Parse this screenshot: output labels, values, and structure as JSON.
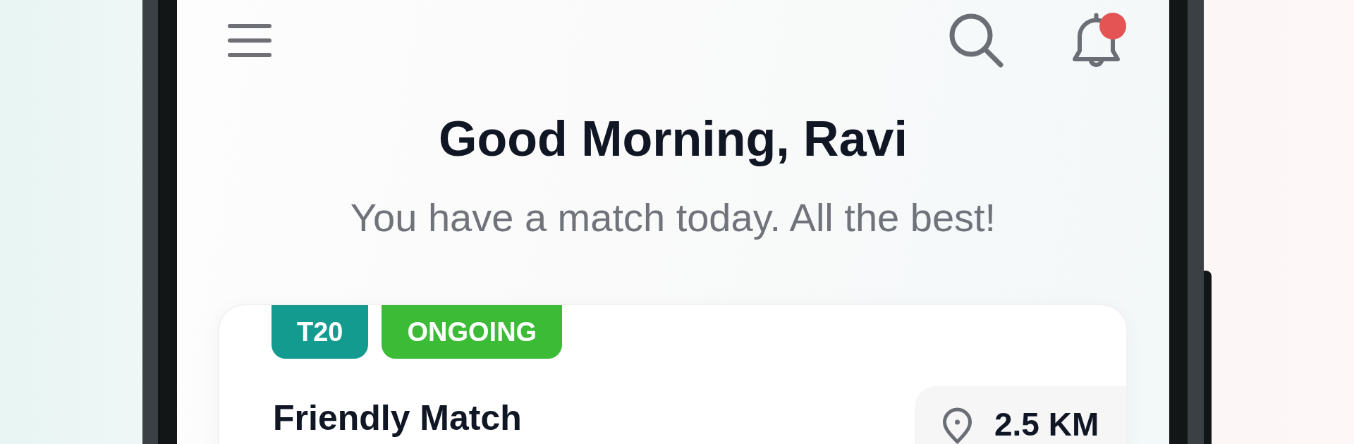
{
  "header": {
    "notifications_unread": true
  },
  "greeting": {
    "title": "Good Morning, Ravi",
    "subtitle": "You have a match today. All the best!"
  },
  "match_card": {
    "tags": [
      {
        "label": "T20",
        "color": "#149b8f"
      },
      {
        "label": "ONGOING",
        "color": "#3bbb36"
      }
    ],
    "title": "Friendly Match",
    "distance": "2.5 KM"
  }
}
